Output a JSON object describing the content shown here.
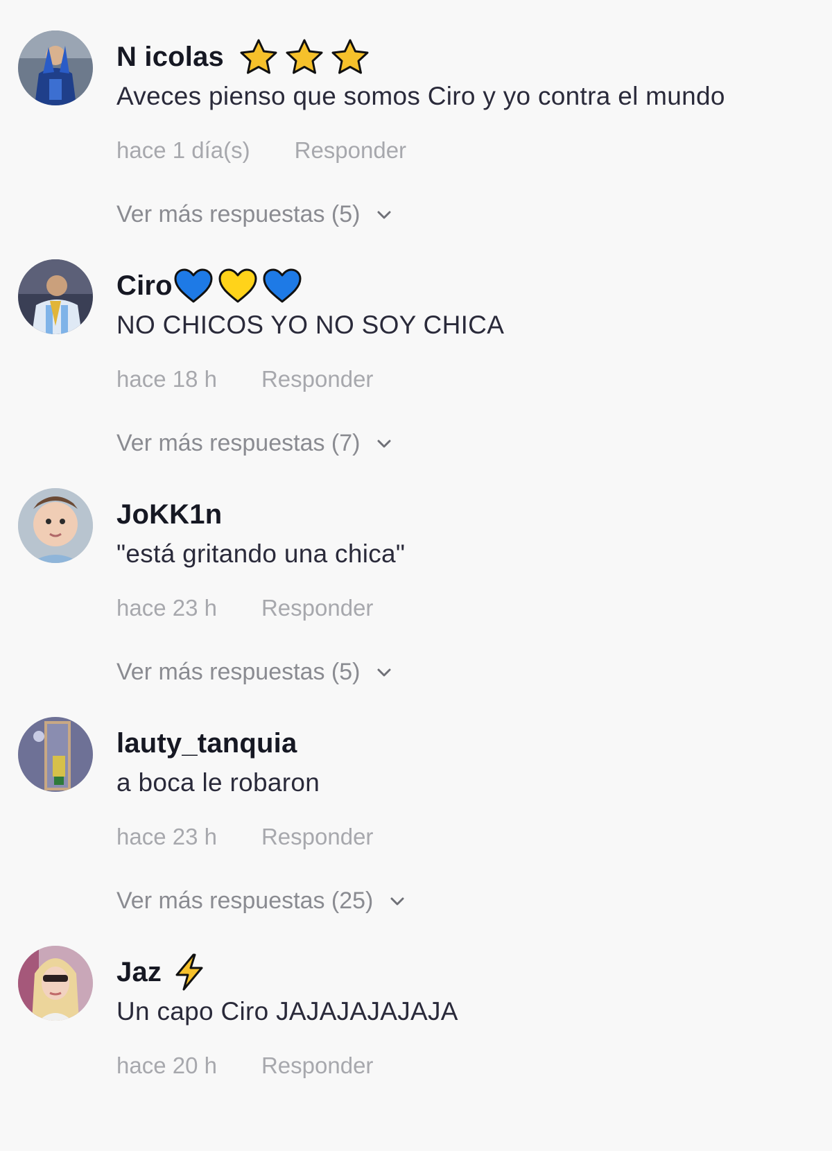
{
  "comments": [
    {
      "username": "N icolas",
      "name_icons": [
        "star-icon",
        "star-icon",
        "star-icon"
      ],
      "text": "Aveces pienso que somos Ciro y yo contra el mundo",
      "time": "hace 1 día(s)",
      "reply_label": "Responder",
      "more_replies": "Ver más respuestas (5)"
    },
    {
      "username": "Ciro",
      "name_icons": [
        "blue-heart-icon",
        "yellow-heart-icon",
        "blue-heart-icon"
      ],
      "text": "NO CHICOS YO NO SOY CHICA",
      "time": "hace 18 h",
      "reply_label": "Responder",
      "more_replies": "Ver más respuestas (7)"
    },
    {
      "username": "JoKK1n",
      "name_icons": [],
      "text": "\"está gritando una chica\"",
      "time": "hace 23 h",
      "reply_label": "Responder",
      "more_replies": "Ver más respuestas (5)"
    },
    {
      "username": "lauty_tanquia",
      "name_icons": [],
      "text": "a boca le robaron",
      "time": "hace 23 h",
      "reply_label": "Responder",
      "more_replies": "Ver más respuestas (25)"
    },
    {
      "username": "Jaz",
      "name_icons": [
        "lightning-icon"
      ],
      "text": "Un capo Ciro JAJAJAJAJAJA",
      "time": "hace 20 h",
      "reply_label": "Responder",
      "more_replies": ""
    }
  ],
  "icons": {
    "more_replies": "chevron-down-icon"
  },
  "colors": {
    "background": "#f8f8f8",
    "username": "#161823",
    "meta": "#a7a8ad",
    "star_fill": "#f6c12b",
    "heart_blue": "#1e7ae6",
    "heart_yellow": "#ffd31a",
    "lightning_fill": "#f6c12b"
  }
}
